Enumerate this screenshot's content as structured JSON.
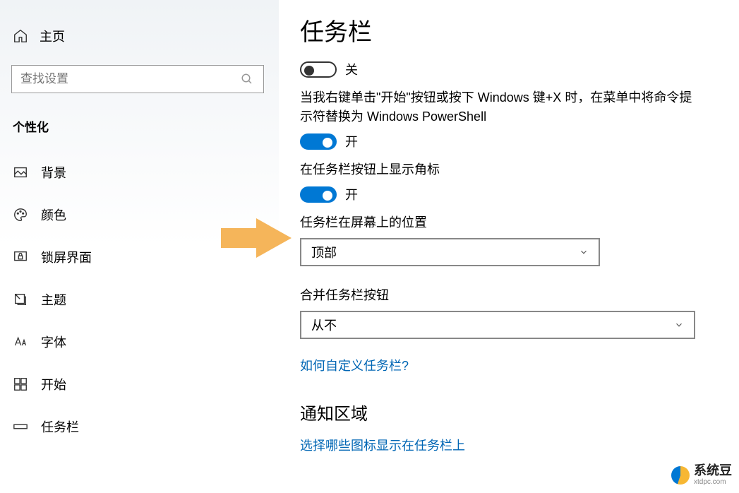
{
  "sidebar": {
    "home_label": "主页",
    "search_placeholder": "查找设置",
    "section_header": "个性化",
    "items": [
      {
        "id": "background",
        "label": "背景"
      },
      {
        "id": "colors",
        "label": "颜色"
      },
      {
        "id": "lock-screen",
        "label": "锁屏界面"
      },
      {
        "id": "themes",
        "label": "主题"
      },
      {
        "id": "fonts",
        "label": "字体"
      },
      {
        "id": "start",
        "label": "开始"
      },
      {
        "id": "taskbar",
        "label": "任务栏"
      }
    ]
  },
  "main": {
    "title": "任务栏",
    "toggle1": {
      "state": "off",
      "state_label": "关"
    },
    "desc1": "当我右键单击\"开始\"按钮或按下 Windows 键+X 时，在菜单中将命令提示符替换为 Windows PowerShell",
    "toggle2": {
      "state": "on",
      "state_label": "开"
    },
    "desc2": "在任务栏按钮上显示角标",
    "toggle3": {
      "state": "on",
      "state_label": "开"
    },
    "position_label": "任务栏在屏幕上的位置",
    "position_value": "顶部",
    "combine_label": "合并任务栏按钮",
    "combine_value": "从不",
    "link1": "如何自定义任务栏?",
    "section2": "通知区域",
    "link2": "选择哪些图标显示在任务栏上"
  },
  "watermark": {
    "name": "系统豆",
    "url": "xtdpc.com"
  }
}
